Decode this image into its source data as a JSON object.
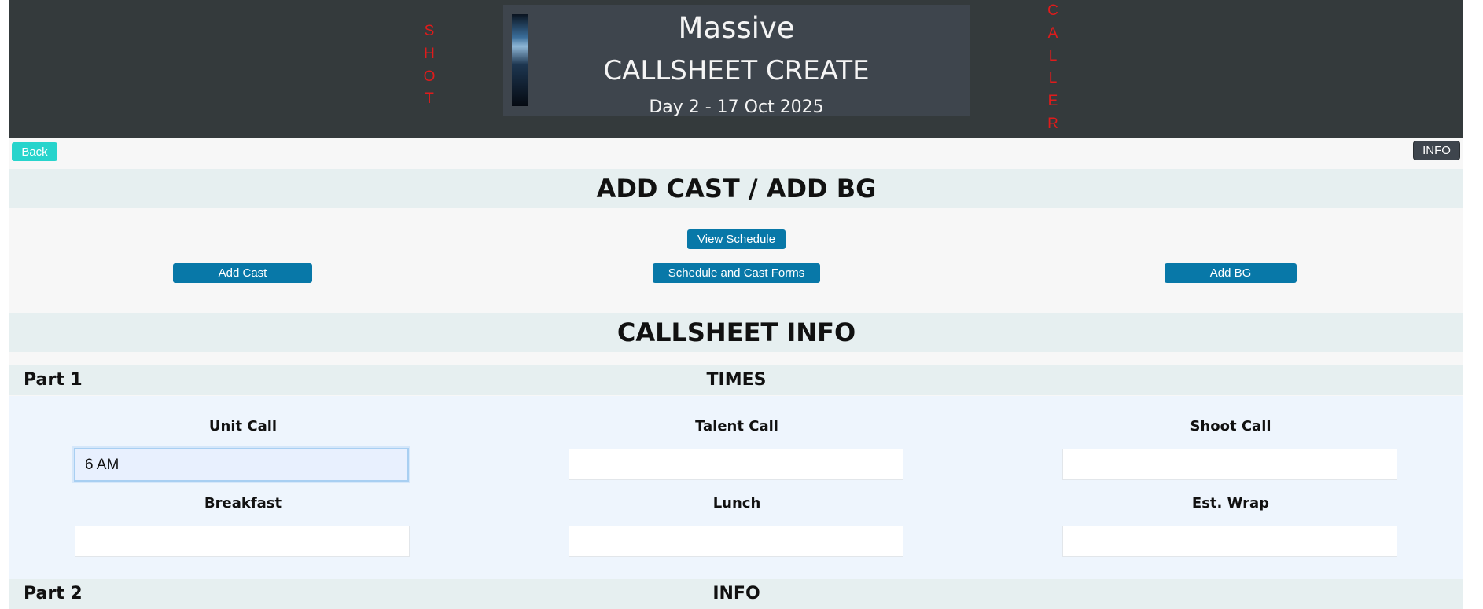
{
  "header": {
    "left_vertical": [
      "S",
      "H",
      "O",
      "T"
    ],
    "right_vertical": [
      "C",
      "A",
      "L",
      "L",
      "E",
      "R"
    ],
    "banner_title": "Massive",
    "banner_subtitle": "CALLSHEET CREATE",
    "banner_date": "Day 2 - 17 Oct 2025"
  },
  "top_controls": {
    "back_label": "Back",
    "info_label": "INFO"
  },
  "cast_section": {
    "title": "ADD CAST / ADD BG",
    "view_schedule_label": "View Schedule",
    "add_cast_label": "Add Cast",
    "schedule_forms_label": "Schedule and Cast Forms",
    "add_bg_label": "Add BG"
  },
  "info_section": {
    "title": "CALLSHEET INFO"
  },
  "part1": {
    "label": "Part 1",
    "heading": "TIMES",
    "fields": {
      "unit_call": {
        "label": "Unit Call",
        "value": "6 AM"
      },
      "talent_call": {
        "label": "Talent Call",
        "value": ""
      },
      "shoot_call": {
        "label": "Shoot Call",
        "value": ""
      },
      "breakfast": {
        "label": "Breakfast",
        "value": ""
      },
      "lunch": {
        "label": "Lunch",
        "value": ""
      },
      "est_wrap": {
        "label": "Est. Wrap",
        "value": ""
      }
    }
  },
  "part2": {
    "label": "Part 2",
    "heading": "INFO"
  },
  "colors": {
    "header_bg": "#343a3c",
    "accent_red": "#e01b1b",
    "button_blue": "#0878a8",
    "button_teal": "#27d4cc"
  }
}
